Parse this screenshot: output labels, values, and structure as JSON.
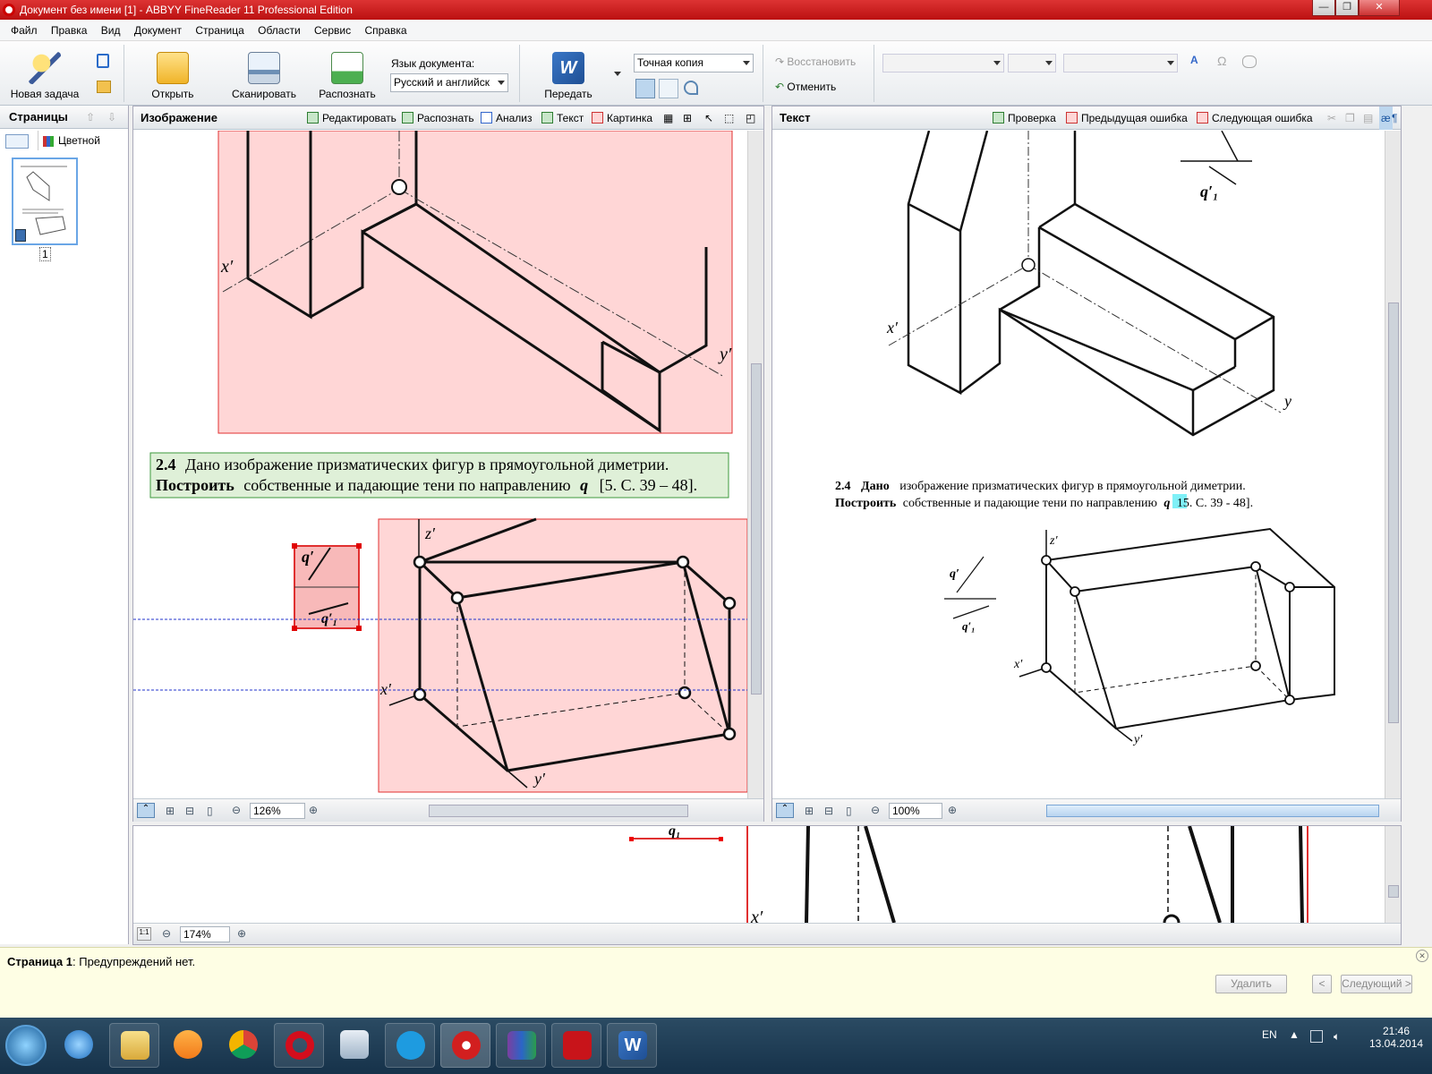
{
  "window": {
    "title": "Документ без имени [1] - ABBYY FineReader 11 Professional Edition"
  },
  "menu": [
    "Файл",
    "Правка",
    "Вид",
    "Документ",
    "Страница",
    "Области",
    "Сервис",
    "Справка"
  ],
  "toolbar": {
    "new_task": "Новая задача",
    "open": "Открыть",
    "scan": "Сканировать",
    "recognize": "Распознать",
    "doc_lang_label": "Язык документа:",
    "doc_lang_value": "Русский и английск",
    "send": "Передать",
    "layout_value": "Точная копия",
    "restore": "Восстановить",
    "undo": "Отменить"
  },
  "pages_panel": {
    "title": "Страницы",
    "mode": "Цветной",
    "page_number": "1"
  },
  "image_pane": {
    "title": "Изображение",
    "tools": [
      "Редактировать",
      "Распознать",
      "Анализ",
      "Текст",
      "Картинка"
    ],
    "zoom": "126%",
    "task_text": {
      "num": "2.4",
      "line1": "Дано изображение призматических фигур в прямоугольной диметрии.",
      "line2_bold": "Построить",
      "line2_rest": "собственные и падающие тени по направлению",
      "line2_q": "q",
      "line2_ref": "[5. С. 39 – 48]."
    },
    "labels": {
      "x": "x′",
      "y": "y′",
      "z": "z′",
      "q": "q′",
      "q1": "q′₁"
    }
  },
  "text_pane": {
    "title": "Текст",
    "tools": [
      "Проверка",
      "Предыдущая ошибка",
      "Следующая ошибка"
    ],
    "zoom": "100%",
    "task_text": {
      "num": "2.4",
      "line1_bold": "Дано",
      "line1_rest": "изображение призматических фигур в прямоугольной диметрии.",
      "line2_bold": "Построить",
      "line2_rest": "собственные и падающие тени по направлению",
      "line2_q": "q",
      "line2_hl": "15",
      "line2_ref": ". С. 39 - 48]."
    },
    "labels": {
      "x": "x′",
      "y": "y",
      "y2": "y′",
      "z": "z′",
      "q": "q′",
      "q1": "q′₁"
    }
  },
  "zoom_pane": {
    "zoom": "174%",
    "labels": {
      "x": "x′",
      "q1": "q₁"
    }
  },
  "warning_bar": {
    "page": "Страница 1",
    "message": ": Предупреждений нет.",
    "delete": "Удалить",
    "prev": "<",
    "next": "Следующий >"
  },
  "taskbar": {
    "lang": "EN",
    "time": "21:46",
    "date": "13.04.2014"
  },
  "colors": {
    "title_red": "#c41e1e",
    "region_pink": "#ffd6d6",
    "region_border": "#e03030",
    "text_region_green": "#dff0d8",
    "text_region_border": "#3c9a3c"
  }
}
